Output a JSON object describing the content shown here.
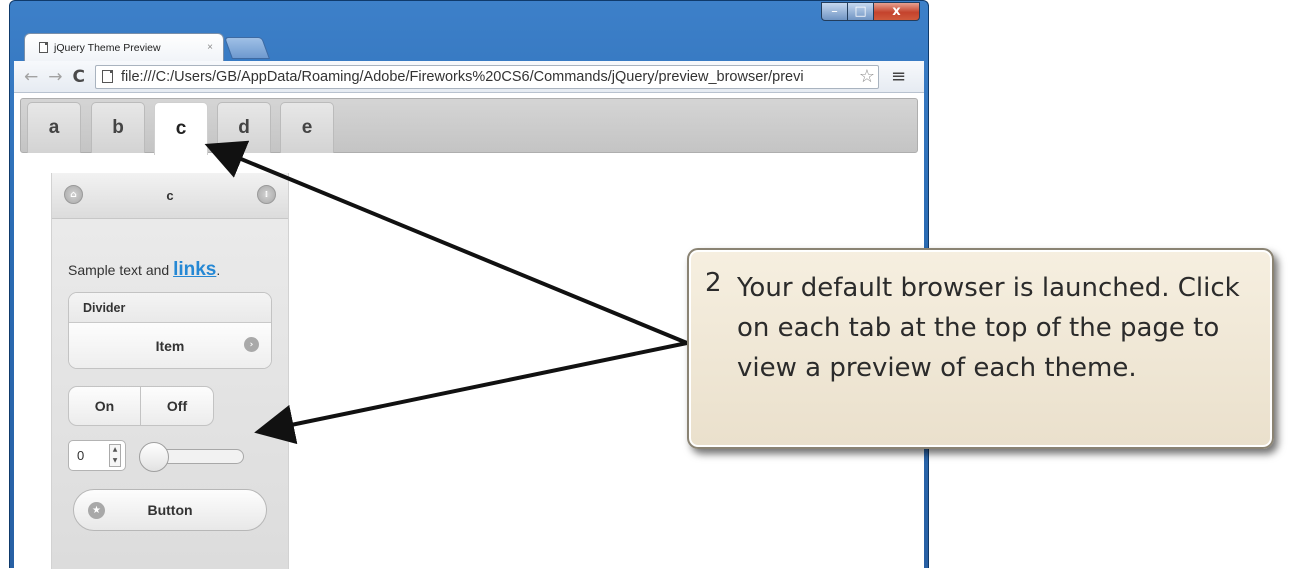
{
  "browser": {
    "tab_title": "jQuery Theme Preview",
    "tab_close": "×",
    "url": "file:///C:/Users/GB/AppData/Roaming/Adobe/Fireworks%20CS6/Commands/jQuery/preview_browser/previ",
    "nav": {
      "back": "←",
      "forward": "→",
      "reload": "C"
    },
    "star": "☆",
    "menu": "≡",
    "window_controls": {
      "minimize": "–",
      "maximize": "□",
      "close": "x"
    }
  },
  "theme_tabs": [
    {
      "label": "a",
      "active": false
    },
    {
      "label": "b",
      "active": false
    },
    {
      "label": "c",
      "active": true
    },
    {
      "label": "d",
      "active": false
    },
    {
      "label": "e",
      "active": false
    }
  ],
  "preview": {
    "header_title": "c",
    "sample_text": "Sample text and ",
    "sample_link": "links",
    "sample_period": ".",
    "list_divider": "Divider",
    "list_item": "Item",
    "toggle_on": "On",
    "toggle_off": "Off",
    "spinner_value": "0",
    "slider_position": 0,
    "button_label": "Button"
  },
  "callout": {
    "number": "2",
    "text": "Your default browser is launched. Click on each tab at the top of the page to view a preview of each theme."
  },
  "colors": {
    "window_frame": "#2b6cb4",
    "link": "#2588d4",
    "callout_bg": "#f2ead9",
    "close_button": "#c4432d"
  }
}
